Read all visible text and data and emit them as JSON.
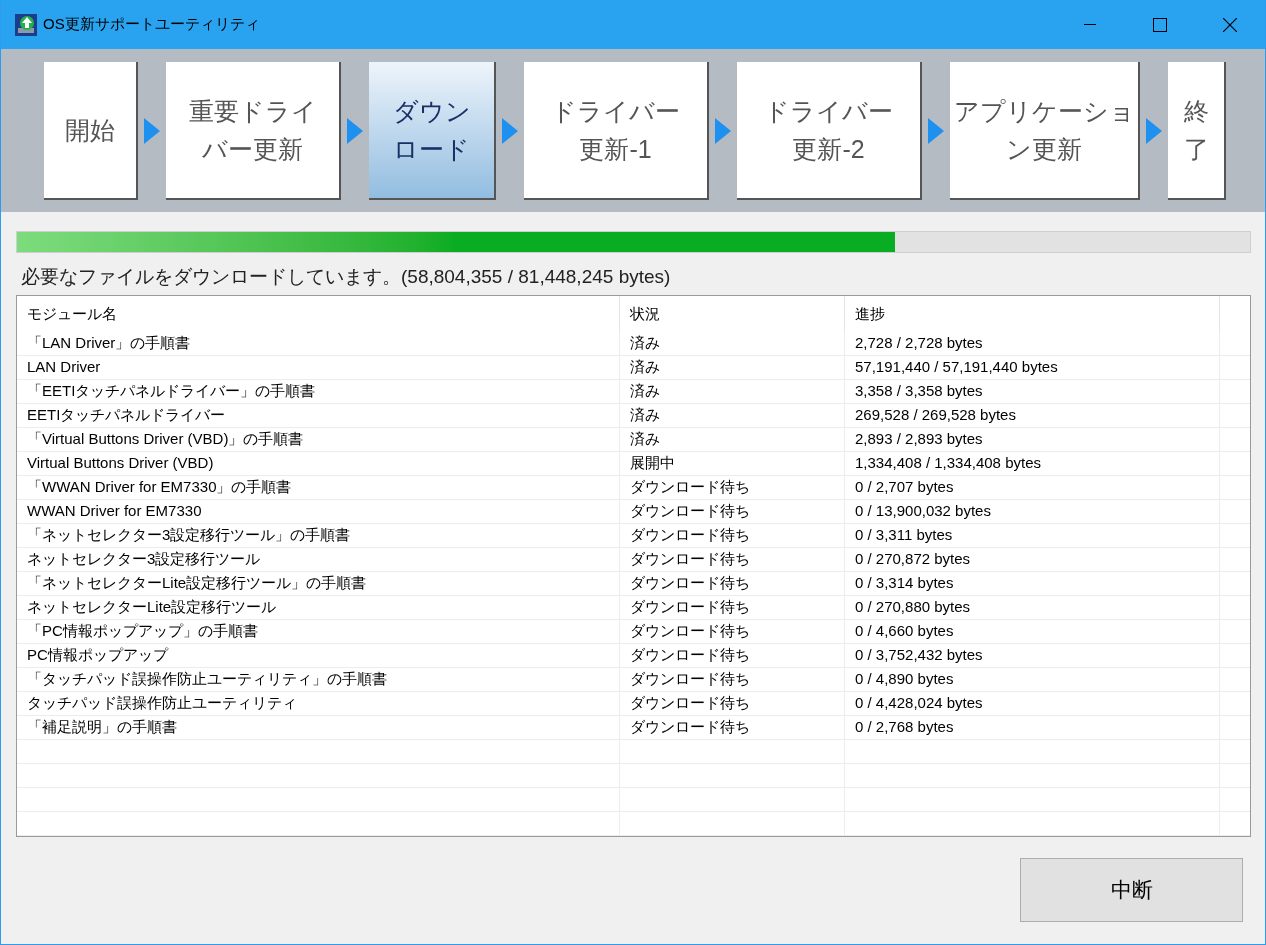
{
  "window": {
    "title": "OS更新サポートユーティリティ"
  },
  "steps": [
    {
      "label": "開始",
      "selected": false
    },
    {
      "label": "重要ドライバー更新",
      "selected": false
    },
    {
      "label": "ダウンロード",
      "selected": true
    },
    {
      "label": "ドライバー更新-1",
      "selected": false
    },
    {
      "label": "ドライバー更新-2",
      "selected": false
    },
    {
      "label": "アプリケーション更新",
      "selected": false
    },
    {
      "label": "終了",
      "selected": false
    }
  ],
  "progress": {
    "level": 0.712,
    "message": "必要なファイルをダウンロードしています。(58,804,355 / 81,448,245 bytes)"
  },
  "table": {
    "columns": [
      "モジュール名",
      "状況",
      "進捗"
    ],
    "rows": [
      [
        "「LAN Driver」の手順書",
        "済み",
        "2,728 / 2,728 bytes"
      ],
      [
        "LAN Driver",
        "済み",
        "57,191,440 / 57,191,440 bytes"
      ],
      [
        "「EETIタッチパネルドライバー」の手順書",
        "済み",
        "3,358 / 3,358 bytes"
      ],
      [
        "EETIタッチパネルドライバー",
        "済み",
        "269,528 / 269,528 bytes"
      ],
      [
        "「Virtual Buttons Driver (VBD)」の手順書",
        "済み",
        "2,893 / 2,893 bytes"
      ],
      [
        "Virtual Buttons Driver (VBD)",
        "展開中",
        "1,334,408 / 1,334,408 bytes"
      ],
      [
        "「WWAN Driver for EM7330」の手順書",
        "ダウンロード待ち",
        "0 / 2,707 bytes"
      ],
      [
        "WWAN Driver for EM7330",
        "ダウンロード待ち",
        "0 / 13,900,032 bytes"
      ],
      [
        "「ネットセレクター3設定移行ツール」の手順書",
        "ダウンロード待ち",
        "0 / 3,311 bytes"
      ],
      [
        "ネットセレクター3設定移行ツール",
        "ダウンロード待ち",
        "0 / 270,872 bytes"
      ],
      [
        "「ネットセレクターLite設定移行ツール」の手順書",
        "ダウンロード待ち",
        "0 / 3,314 bytes"
      ],
      [
        "ネットセレクターLite設定移行ツール",
        "ダウンロード待ち",
        "0 / 270,880 bytes"
      ],
      [
        "「PC情報ポップアップ」の手順書",
        "ダウンロード待ち",
        "0 / 4,660 bytes"
      ],
      [
        "PC情報ポップアップ",
        "ダウンロード待ち",
        "0 / 3,752,432 bytes"
      ],
      [
        "「タッチパッド誤操作防止ユーティリティ」の手順書",
        "ダウンロード待ち",
        "0 / 4,890 bytes"
      ],
      [
        "タッチパッド誤操作防止ユーティリティ",
        "ダウンロード待ち",
        "0 / 4,428,024 bytes"
      ],
      [
        "「補足説明」の手順書",
        "ダウンロード待ち",
        "0 / 2,768 bytes"
      ]
    ]
  },
  "buttons": [
    "中断"
  ]
}
